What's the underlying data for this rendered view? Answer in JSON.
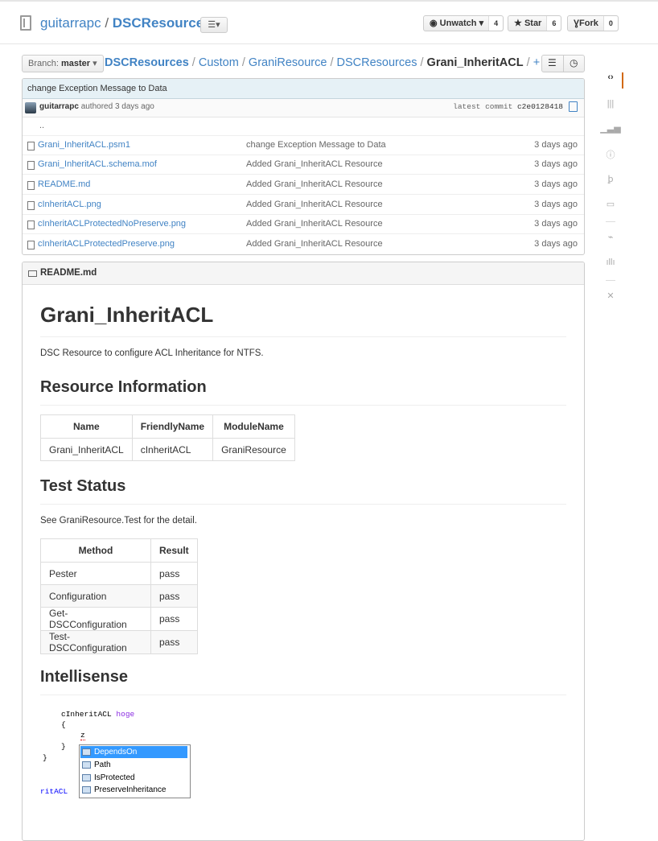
{
  "header": {
    "owner": "guitarrapc",
    "separator": " / ",
    "repo": "DSCResources",
    "menu_icon": "list-menu-icon",
    "unwatch_label": "Unwatch",
    "unwatch_count": "4",
    "star_label": "Star",
    "star_count": "6",
    "fork_label": "Fork",
    "fork_count": "0"
  },
  "breadcrumb": {
    "branch_prefix": "Branch:",
    "branch": "master",
    "parts": [
      "DSCResources",
      "Custom",
      "GraniResource",
      "DSCResources"
    ],
    "sep": " / ",
    "current": "Grani_InheritACL",
    "plus": "+"
  },
  "commit": {
    "message": "change Exception Message to Data",
    "author": "guitarrapc",
    "authored": "authored 3 days ago",
    "latest_label": "latest commit",
    "sha": "c2e0128418"
  },
  "files": {
    "updir": "..",
    "rows": [
      {
        "name": "Grani_InheritACL.psm1",
        "message": "change Exception Message to Data",
        "age": "3 days ago"
      },
      {
        "name": "Grani_InheritACL.schema.mof",
        "message": "Added Grani_InheritACL Resource",
        "age": "3 days ago"
      },
      {
        "name": "README.md",
        "message": "Added Grani_InheritACL Resource",
        "age": "3 days ago"
      },
      {
        "name": "cInheritACL.png",
        "message": "Added Grani_InheritACL Resource",
        "age": "3 days ago"
      },
      {
        "name": "cInheritACLProtectedNoPreserve.png",
        "message": "Added Grani_InheritACL Resource",
        "age": "3 days ago"
      },
      {
        "name": "cInheritACLProtectedPreserve.png",
        "message": "Added Grani_InheritACL Resource",
        "age": "3 days ago"
      }
    ]
  },
  "readme": {
    "file": "README.md",
    "title": "Grani_InheritACL",
    "intro": "DSC Resource to configure ACL Inheritance for NTFS.",
    "resource_heading": "Resource Information",
    "resource_table": {
      "headers": [
        "Name",
        "FriendlyName",
        "ModuleName"
      ],
      "row": [
        "Grani_InheritACL",
        "cInheritACL",
        "GraniResource"
      ]
    },
    "test_heading": "Test Status",
    "test_intro": "See GraniResource.Test for the detail.",
    "test_table": {
      "headers": [
        "Method",
        "Result"
      ],
      "rows": [
        [
          "Pester",
          "pass"
        ],
        [
          "Configuration",
          "pass"
        ],
        [
          "Get-DSCConfiguration",
          "pass"
        ],
        [
          "Test-DSCConfiguration",
          "pass"
        ]
      ]
    },
    "intellisense_heading": "Intellisense",
    "code": {
      "line1_a": "cInheritACL",
      "line1_b": "hoge",
      "brace_open": "{",
      "typed": "z",
      "brace_close": "}",
      "outer_close": "}",
      "tail": "ritACL"
    },
    "completions": [
      "DependsOn",
      "Path",
      "IsProtected",
      "PreserveInheritance"
    ]
  },
  "sidebar": {
    "icons": [
      "code-icon",
      "issues-icon",
      "pulse-icon",
      "info-icon",
      "pull-request-icon",
      "wiki-icon",
      "activity-icon",
      "graphs-icon",
      "settings-icon"
    ],
    "glyphs": [
      "‹›",
      "|||",
      "▁▃▅",
      "ⓘ",
      "ꝧ",
      "▭",
      "⌁",
      "ıllı",
      "✕"
    ]
  },
  "colors": {
    "link": "#4183c4",
    "accent": "#d26911",
    "commit_bg": "#e6f1f6"
  }
}
